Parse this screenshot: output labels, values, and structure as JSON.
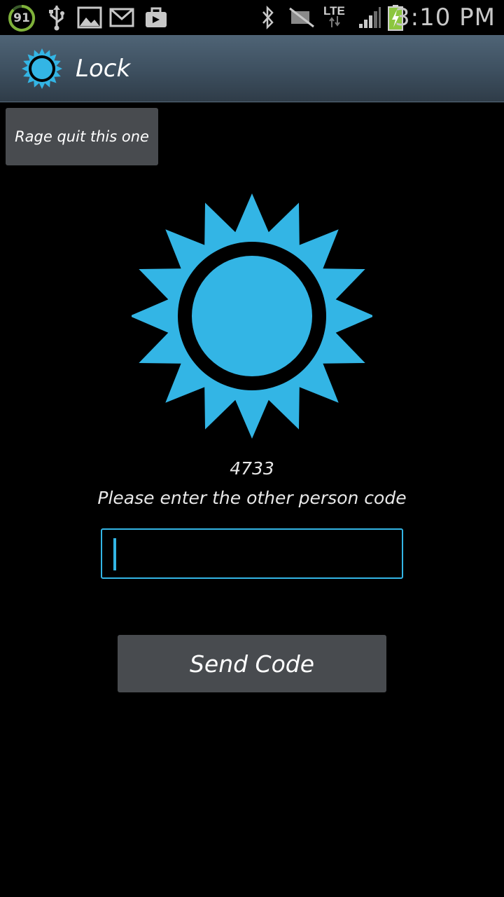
{
  "status_bar": {
    "battery_percent": "91",
    "network_type": "LTE",
    "time": "3:10 PM",
    "icons": [
      "battery-level-icon",
      "usb-icon",
      "gallery-icon",
      "email-icon",
      "briefcase-icon",
      "bluetooth-icon",
      "mute-icon",
      "lte-icon",
      "signal-icon",
      "battery-charging-icon"
    ]
  },
  "action_bar": {
    "title": "Lock",
    "icon": "sun-icon"
  },
  "rage_quit_button": {
    "label": "Rage quit this one"
  },
  "main": {
    "code": "4733",
    "instruction": "Please enter the other person code",
    "input": {
      "value": "",
      "placeholder": ""
    },
    "send_button_label": "Send Code"
  },
  "colors": {
    "accent": "#33b5e5",
    "button_bg": "#484b4f",
    "background": "#000000",
    "action_bar": "#3d4f5f"
  }
}
